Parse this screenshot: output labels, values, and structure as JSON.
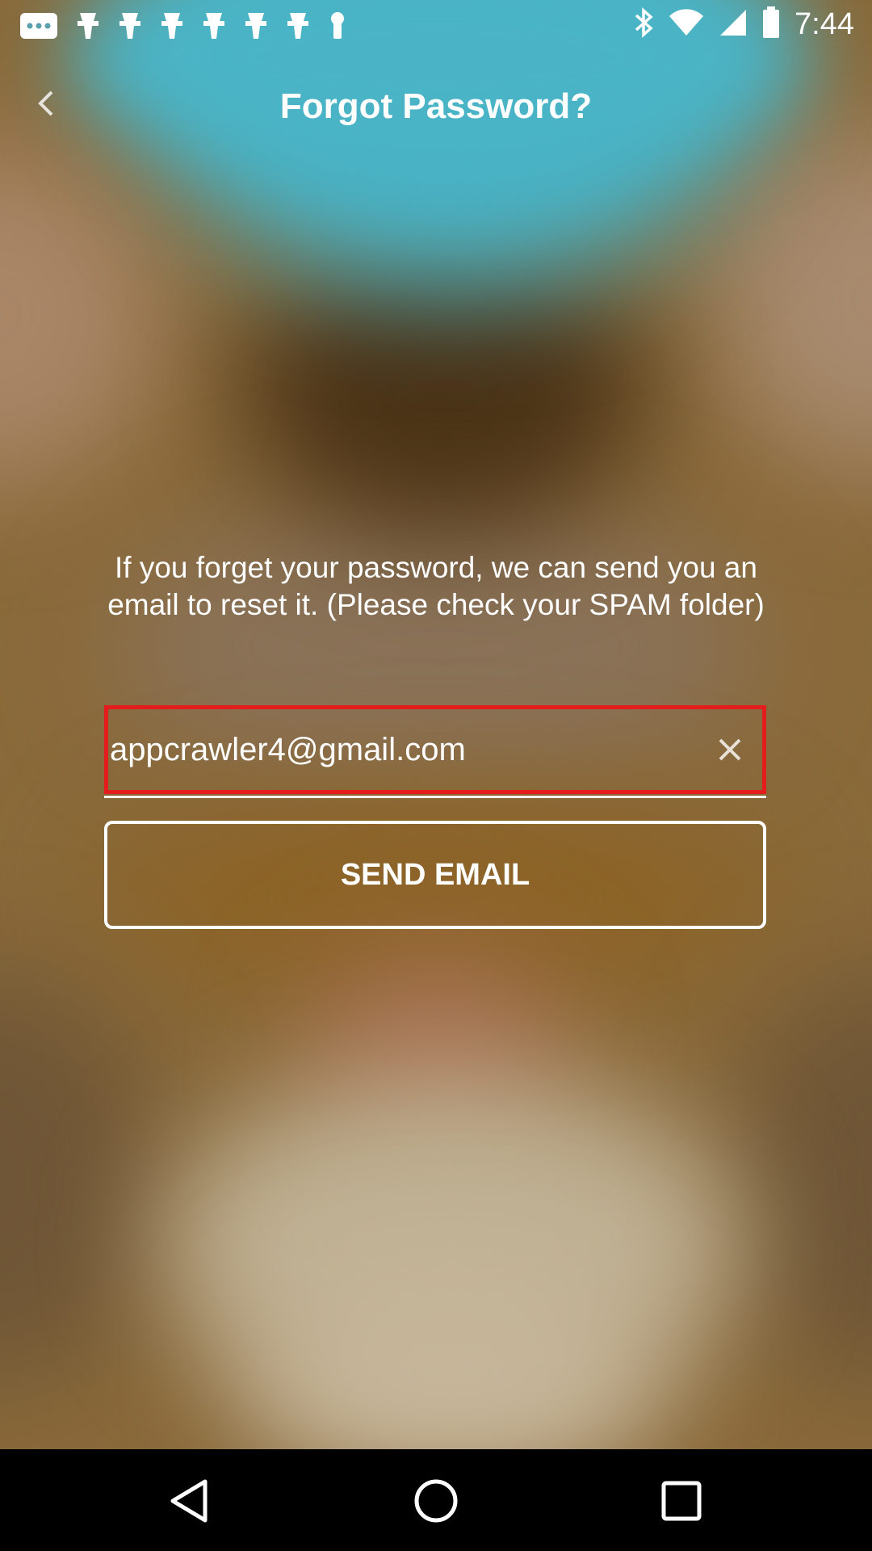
{
  "status_bar": {
    "time": "7:44",
    "left_icons": [
      "more-icon",
      "notification-icon",
      "notification-icon",
      "notification-icon",
      "notification-icon",
      "notification-icon",
      "notification-icon",
      "keyhole-icon"
    ],
    "right_icons": [
      "bluetooth-icon",
      "wifi-icon",
      "signal-icon",
      "battery-icon"
    ]
  },
  "header": {
    "title": "Forgot Password?"
  },
  "main": {
    "description": "If you forget your password, we can send you an email to reset it. (Please check your SPAM folder)",
    "email_input": {
      "value": "appcrawler4@gmail.com"
    },
    "send_button_label": "SEND EMAIL"
  },
  "nav_bar": {
    "buttons": [
      "back-icon",
      "home-icon",
      "recents-icon"
    ]
  },
  "colors": {
    "highlight_border": "#e51c1c",
    "text": "#ffffff"
  }
}
